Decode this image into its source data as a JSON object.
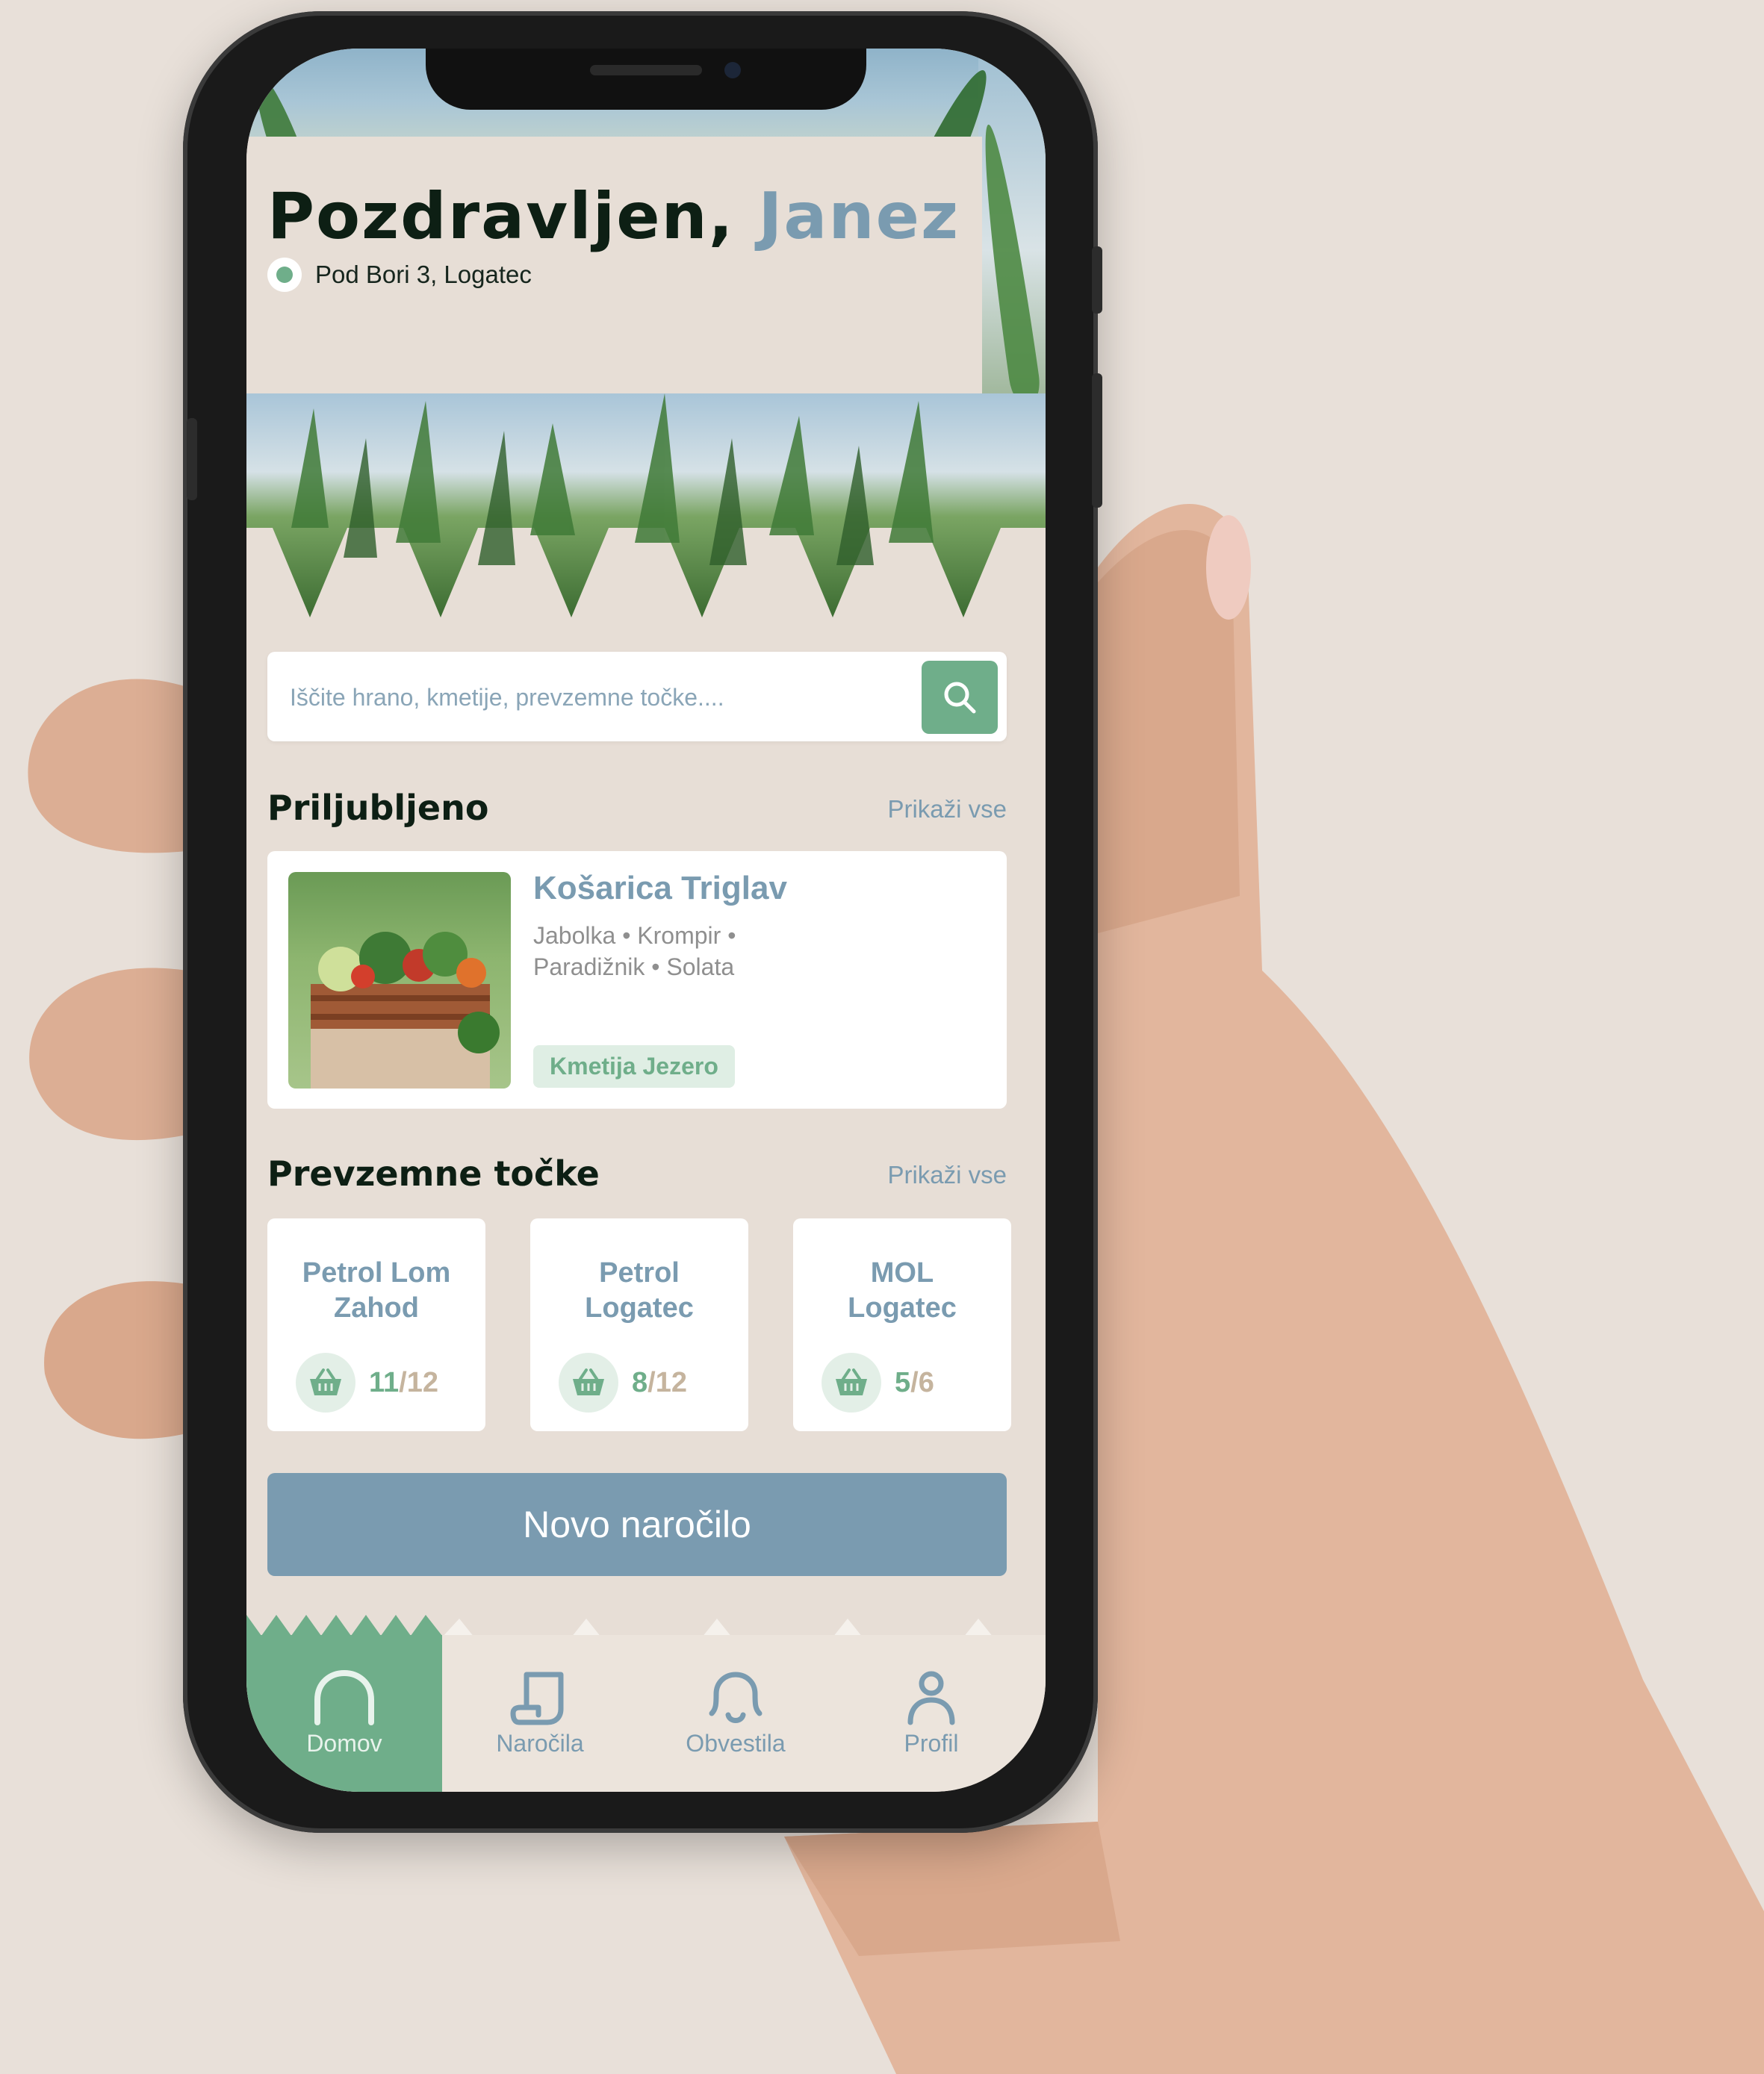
{
  "greeting": {
    "prefix": "Pozdravljen,",
    "name": "Janez"
  },
  "location": {
    "address": "Pod Bori 3, Logatec"
  },
  "search": {
    "placeholder": "Iščite hrano, kmetije, prevzemne točke...."
  },
  "favorites": {
    "title": "Priljubljeno",
    "show_all": "Prikaži vse",
    "items": [
      {
        "name": "Košarica Triglav",
        "contents": "Jabolka • Krompir • Paradižnik • Solata",
        "farm": "Kmetija Jezero"
      }
    ]
  },
  "pickup_points": {
    "title": "Prevzemne točke",
    "show_all": "Prikaži vse",
    "items": [
      {
        "name": "Petrol Lom Zahod",
        "available": "11",
        "total": "/12"
      },
      {
        "name": "Petrol Logatec",
        "available": "8",
        "total": "/12"
      },
      {
        "name": "MOL Logatec",
        "available": "5",
        "total": "/6"
      }
    ]
  },
  "cta": {
    "label": "Novo naročilo"
  },
  "nav": {
    "active": "Domov",
    "items": [
      {
        "label": "Domov",
        "icon": "home-icon"
      },
      {
        "label": "Naročila",
        "icon": "scroll-icon"
      },
      {
        "label": "Obvestila",
        "icon": "bell-icon"
      },
      {
        "label": "Profil",
        "icon": "user-icon"
      }
    ]
  },
  "colors": {
    "accent_green": "#6fae8a",
    "accent_blue": "#7a9bb0",
    "background": "#e7ded6",
    "text_dark": "#0d1f14"
  }
}
